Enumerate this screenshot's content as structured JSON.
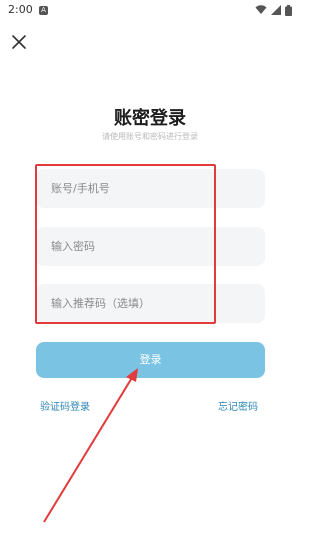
{
  "status_bar": {
    "time": "2:00",
    "notification_glyph": "A"
  },
  "icons": {
    "close": "close-icon",
    "wifi": "wifi-icon",
    "signal": "signal-icon",
    "battery": "battery-icon"
  },
  "login": {
    "title": "账密登录",
    "subtitle": "请使用账号和密码进行登录",
    "account_placeholder": "账号/手机号",
    "password_placeholder": "输入密码",
    "referral_placeholder": "输入推荐码（选填）",
    "login_button": "登录",
    "sms_login_link": "验证码登录",
    "forgot_password_link": "忘记密码"
  },
  "colors": {
    "accent": "#7bc3e3",
    "link": "#2b86b4",
    "annotation": "#e23b3b"
  }
}
